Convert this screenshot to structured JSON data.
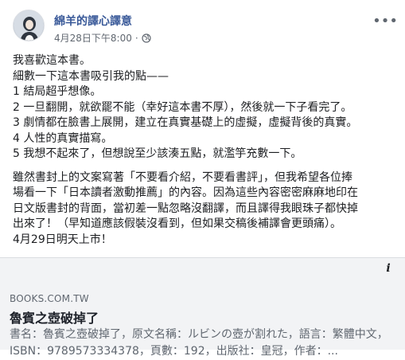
{
  "post": {
    "page_name": "綿羊的譯心譯意",
    "timestamp": "4月28日下午8:00",
    "separator": "·",
    "lines": [
      "我喜歡這本書。",
      "細數一下這本書吸引我的點——",
      "1 結局超乎想像。",
      "2 一旦翻開，就欲罷不能（幸好這本書不厚），然後就一下子看完了。",
      "3 劇情都在臉書上展開，建立在真實基礎上的虛擬，虛擬背後的真實。",
      "4 人性的真實描寫。",
      "5 我想不起來了，但想說至少該湊五點，就濫竽充數一下。"
    ],
    "paragraph": [
      "雖然書封上的文案寫著「不要看介紹，不要看書評」，但我希望各位捧",
      "場看一下「日本讀者激動推薦」的內容。因為這些內容密密麻麻地印在",
      "日文版書封的背面，當初差一點忽略沒翻譯，而且譯得我眼珠子都快掉",
      "出來了！（早知道應該假裝沒看到，但如果交稿後補譯會更頭痛）。",
      "4月29日明天上市！"
    ]
  },
  "link_card": {
    "domain": "BOOKS.COM.TW",
    "title": "魯賓之壺破掉了",
    "description": "書名：魯賓之壺破掉了，原文名稱：ルビンの壺が割れた，語言：繁體中文，ISBN：9789573334378，頁數：192，出版社：皇冠，作者：..."
  },
  "icons": {
    "more": "more-icon",
    "globe": "globe-icon",
    "info": "info-icon"
  },
  "colors": {
    "page_name": "#385898",
    "meta_text": "#606770",
    "card_bg": "#f2f3f5"
  }
}
